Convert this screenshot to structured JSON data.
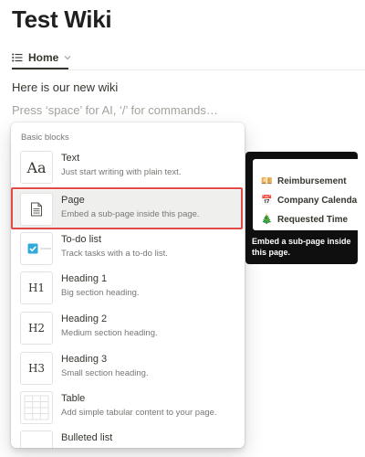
{
  "page": {
    "title": "Test Wiki"
  },
  "view": {
    "label": "Home"
  },
  "content": {
    "line": "Here is our new wiki",
    "placeholder": "Press ‘space’ for AI, ‘/’ for commands…"
  },
  "menu": {
    "section": "Basic blocks",
    "items": [
      {
        "label": "Text",
        "desc": "Just start writing with plain text.",
        "icon": "text-aa-icon",
        "thumb": "Aa"
      },
      {
        "label": "Page",
        "desc": "Embed a sub-page inside this page.",
        "icon": "page-icon"
      },
      {
        "label": "To-do list",
        "desc": "Track tasks with a to-do list.",
        "icon": "checkbox-icon"
      },
      {
        "label": "Heading 1",
        "desc": "Big section heading.",
        "icon": "heading-1-icon",
        "thumb": "H1"
      },
      {
        "label": "Heading 2",
        "desc": "Medium section heading.",
        "icon": "heading-2-icon",
        "thumb": "H2"
      },
      {
        "label": "Heading 3",
        "desc": "Small section heading.",
        "icon": "heading-3-icon",
        "thumb": "H3"
      },
      {
        "label": "Table",
        "desc": "Add simple tabular content to your page.",
        "icon": "table-icon"
      },
      {
        "label": "Bulleted list",
        "desc": "",
        "icon": "bullet-list-icon"
      }
    ]
  },
  "tooltip": {
    "preview": [
      {
        "emoji": "💴",
        "text": "Reimbursement"
      },
      {
        "emoji": "📅",
        "text": "Company Calendar"
      },
      {
        "emoji": "🎄",
        "text": "Requested Time"
      }
    ],
    "text": "Embed a sub-page inside this page."
  },
  "colors": {
    "highlight": "#e24a4a",
    "checkbox": "#2eaadc",
    "tooltip_bg": "#0f0f0f"
  }
}
